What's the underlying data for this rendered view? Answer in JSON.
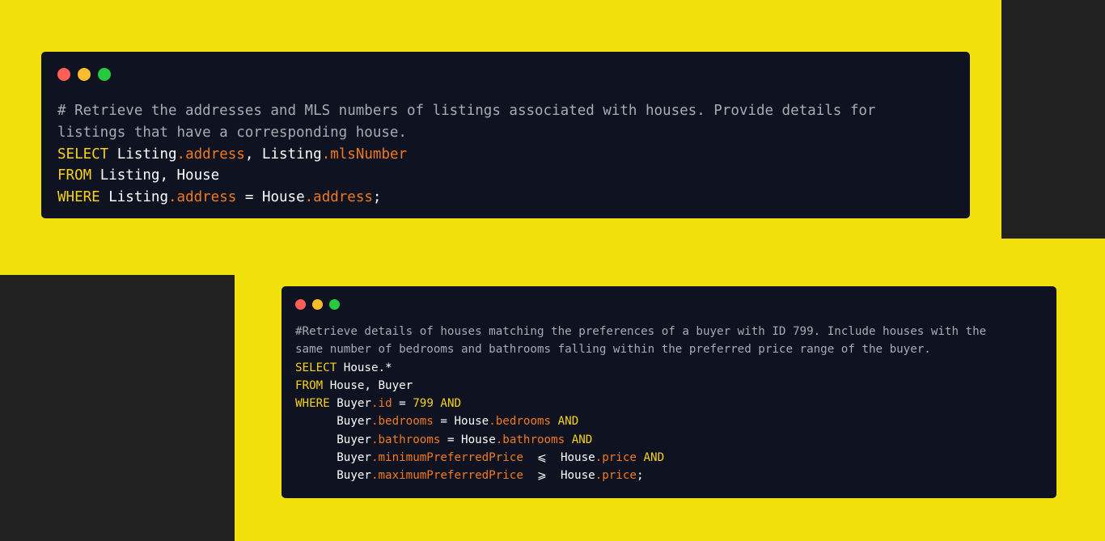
{
  "windows": [
    {
      "lines": {
        "comment1": "# Retrieve the addresses and MLS numbers of listings associated with houses. Provide details for",
        "comment2": "listings that have a corresponding house.",
        "select_kw": "SELECT",
        "from_kw": "FROM",
        "from_tables": "Listing, House",
        "where_kw": "WHERE",
        "listing": "Listing",
        "house": "House",
        "address_prop": ".address",
        "mls_prop": ".mlsNumber",
        "comma": ",",
        "eq": "=",
        "semicolon": ";"
      }
    },
    {
      "lines": {
        "comment1": "#Retrieve details of houses matching the preferences of a buyer with ID 799. Include houses with the",
        "comment2": "same number of bedrooms and bathrooms falling within the preferred price range of the buyer.",
        "select_kw": "SELECT",
        "select_what": "House.*",
        "from_kw": "FROM",
        "from_tables": "House, Buyer",
        "where_kw": "WHERE",
        "and_kw": "AND",
        "buyer": "Buyer",
        "house": "House",
        "id_prop": ".id",
        "id_value": "799",
        "bedrooms_prop": ".bedrooms",
        "bathrooms_prop": ".bathrooms",
        "min_price_prop": ".minimumPreferredPrice",
        "max_price_prop": ".maximumPreferredPrice",
        "price_prop": ".price",
        "eq": "=",
        "lte": "⩽",
        "gte": "⩾",
        "semicolon": ";"
      }
    }
  ]
}
